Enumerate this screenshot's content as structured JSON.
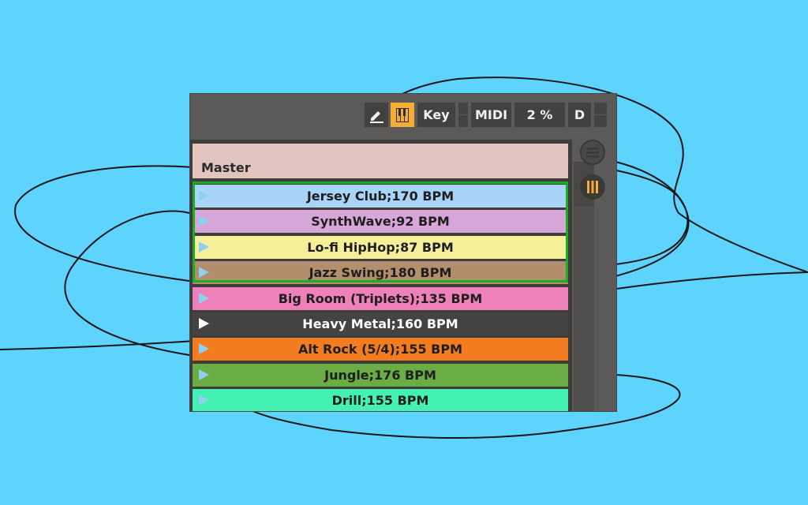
{
  "toolbar": {
    "pen_icon": "pencil-icon",
    "piano_icon": "piano-keys-icon",
    "key_label": "Key",
    "midi_label": "MIDI",
    "percent_label": "2 %",
    "d_label": "D"
  },
  "master": {
    "label": "Master"
  },
  "tracks": [
    {
      "label": "Jersey Club;170 BPM",
      "color": "#a9d3f7"
    },
    {
      "label": "SynthWave;92 BPM",
      "color": "#d7a7d9"
    },
    {
      "label": "Lo-fi HipHop;87 BPM",
      "color": "#f6ef9a"
    },
    {
      "label": "Jazz Swing;180 BPM",
      "color": "#b28e6d"
    },
    {
      "label": "Big Room (Triplets);135 BPM",
      "color": "#ee81b9"
    },
    {
      "label": "Heavy Metal;160 BPM",
      "color": "#444342"
    },
    {
      "label": "Alt Rock (5/4);155 BPM",
      "color": "#f47c20"
    },
    {
      "label": "Jungle;176 BPM",
      "color": "#6aad45"
    },
    {
      "label": "Drill;155 BPM",
      "color": "#43f2b2"
    }
  ],
  "colors": {
    "background": "#5dd3fd",
    "accent": "#f5ae32",
    "selection": "#18b020"
  },
  "side_icons": [
    "list-icon",
    "columns-icon"
  ]
}
